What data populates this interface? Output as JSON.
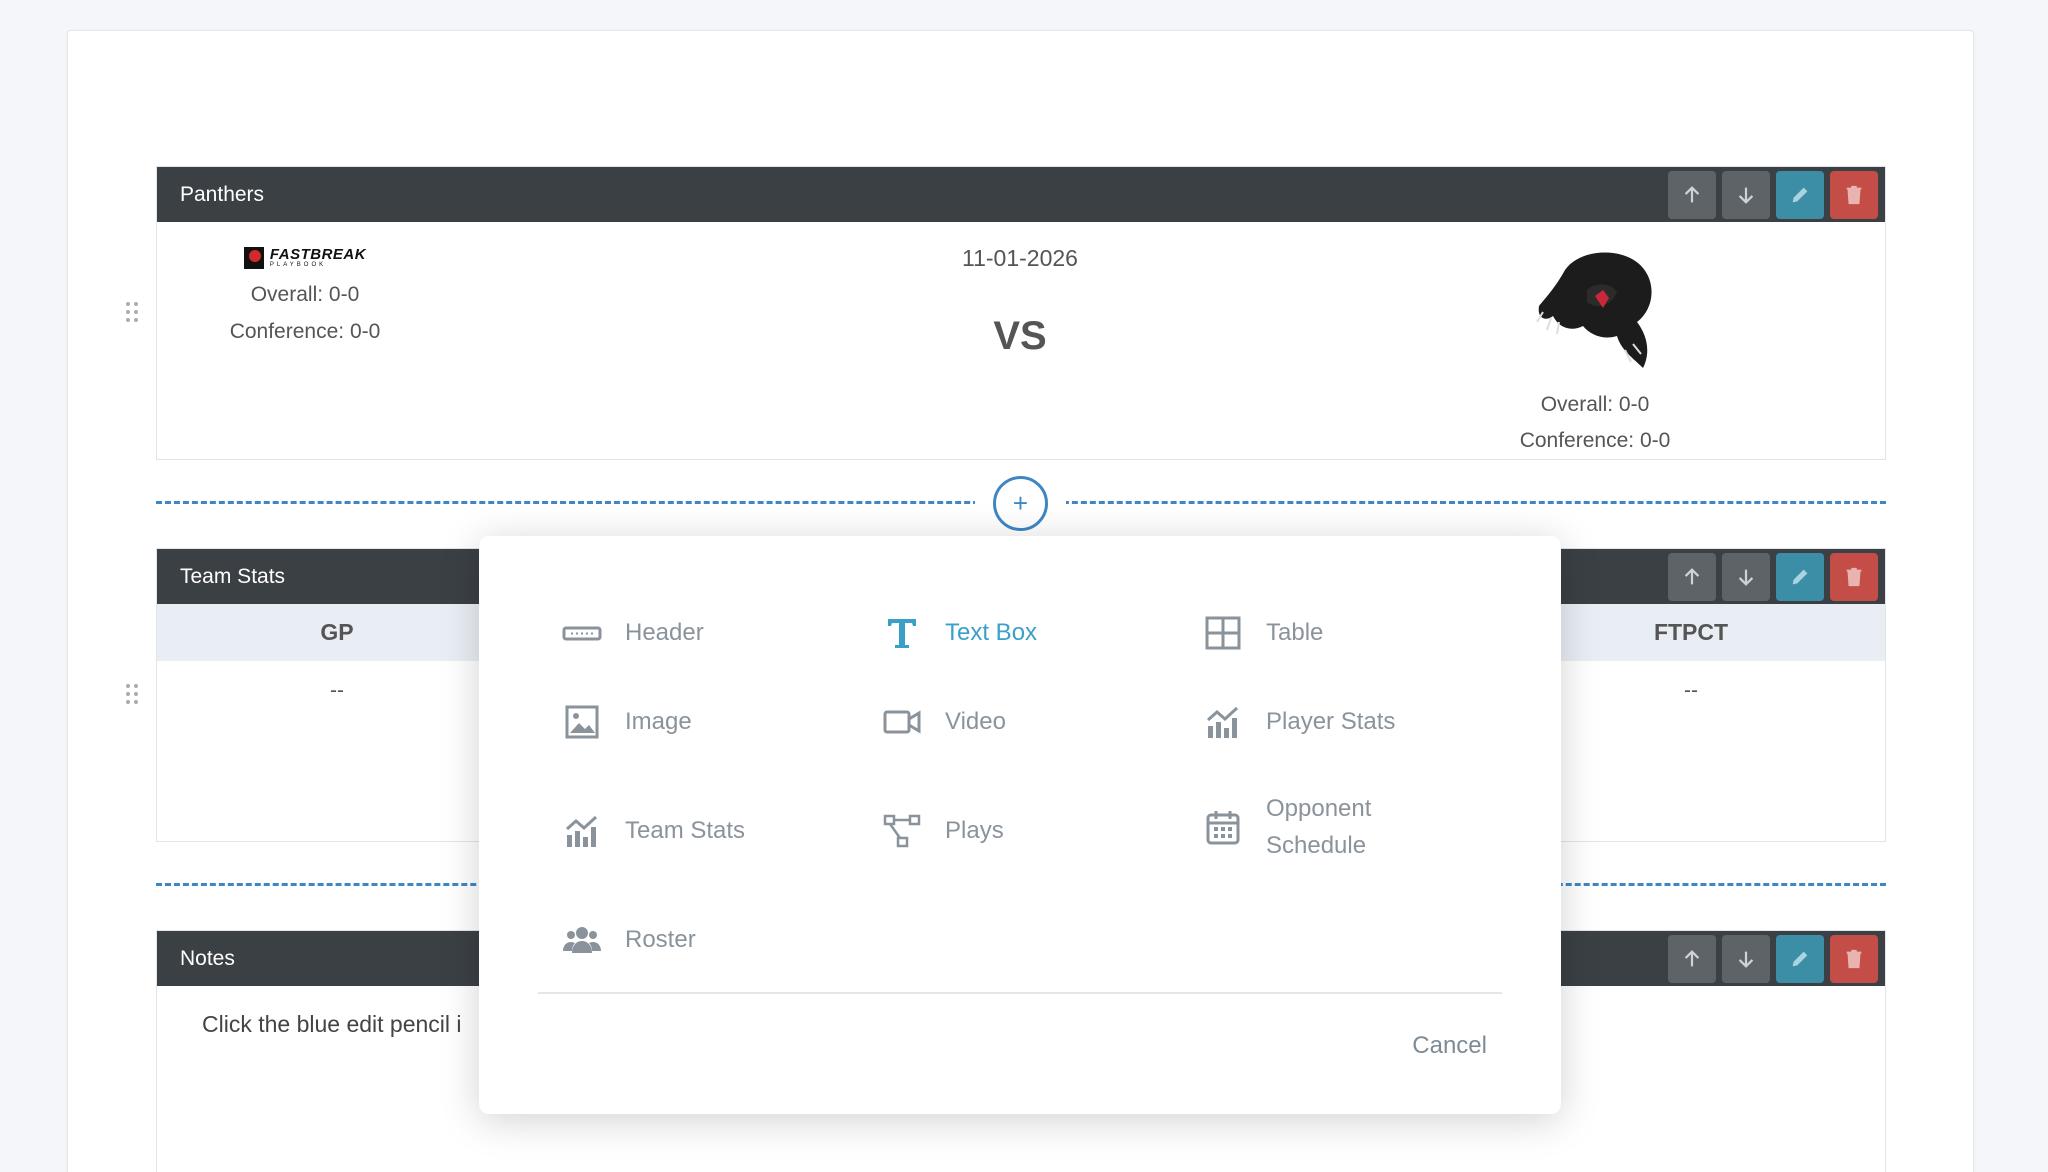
{
  "sections": {
    "game": {
      "title": "Panthers",
      "home": {
        "logo_line1": "FASTBREAK",
        "logo_line2": "PLAYBOOK",
        "overall": "Overall: 0-0",
        "conference": "Conference: 0-0"
      },
      "date": "11-01-2026",
      "vs": "VS",
      "away": {
        "overall": "Overall: 0-0",
        "conference": "Conference: 0-0"
      }
    },
    "stats": {
      "title": "Team Stats",
      "columns": [
        {
          "header": "GP",
          "value": "--"
        },
        {
          "header": "FTPCT",
          "value": "--"
        }
      ]
    },
    "notes": {
      "title": "Notes",
      "text": "Click the blue edit pencil i"
    }
  },
  "modal": {
    "options": [
      {
        "label": "Header",
        "icon": "header-icon"
      },
      {
        "label": "Text Box",
        "icon": "text-icon",
        "active": true
      },
      {
        "label": "Table",
        "icon": "table-icon"
      },
      {
        "label": "Image",
        "icon": "image-icon"
      },
      {
        "label": "Video",
        "icon": "video-icon"
      },
      {
        "label": "Player Stats",
        "icon": "chart-icon"
      },
      {
        "label": "Team Stats",
        "icon": "chart-icon"
      },
      {
        "label": "Plays",
        "icon": "plays-icon"
      },
      {
        "label_line1": "Opponent",
        "label_line2": "Schedule",
        "icon": "calendar-icon"
      },
      {
        "label": "Roster",
        "icon": "users-icon"
      }
    ],
    "cancel_label": "Cancel"
  },
  "colors": {
    "header_bg": "#3b4045",
    "accent": "#3f86c4",
    "edit": "#3b8ea5",
    "delete": "#c44d47",
    "active_option": "#3aa0c8"
  }
}
